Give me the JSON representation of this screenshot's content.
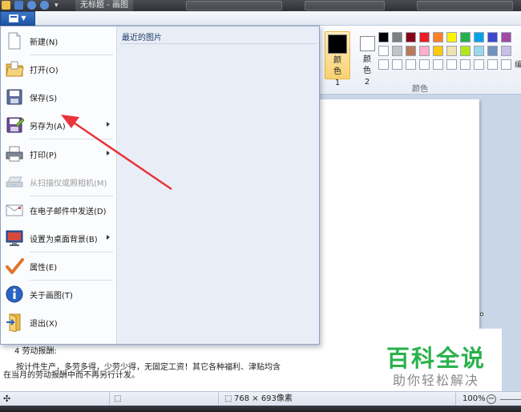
{
  "titlebar": {
    "title": "无标题 - 画图"
  },
  "file_menu": {
    "items": [
      {
        "label": "新建(N)",
        "icon": "new-file-icon",
        "submenu": false,
        "enabled": true
      },
      {
        "label": "打开(O)",
        "icon": "open-folder-icon",
        "submenu": false,
        "enabled": true
      },
      {
        "label": "保存(S)",
        "icon": "save-disk-icon",
        "submenu": false,
        "enabled": true
      },
      {
        "label": "另存为(A)",
        "icon": "save-as-icon",
        "submenu": true,
        "enabled": true
      },
      {
        "label": "打印(P)",
        "icon": "printer-icon",
        "submenu": true,
        "enabled": true
      },
      {
        "label": "从扫描仪或照相机(M)",
        "icon": "scanner-icon",
        "submenu": false,
        "enabled": false
      },
      {
        "label": "在电子邮件中发送(D)",
        "icon": "email-icon",
        "submenu": false,
        "enabled": true
      },
      {
        "label": "设置为桌面背景(B)",
        "icon": "desktop-background-icon",
        "submenu": true,
        "enabled": true
      },
      {
        "label": "属性(E)",
        "icon": "properties-check-icon",
        "submenu": false,
        "enabled": true
      },
      {
        "label": "关于画图(T)",
        "icon": "info-icon",
        "submenu": false,
        "enabled": true
      },
      {
        "label": "退出(X)",
        "icon": "exit-icon",
        "submenu": false,
        "enabled": true
      }
    ],
    "recent_title": "最近的图片"
  },
  "ribbon": {
    "color1_label": "颜色 1",
    "color2_label": "颜色 2",
    "colors_group_label": "颜色",
    "edit_colors_label": "编",
    "color1": "#000000",
    "color2": "#ffffff",
    "palette": [
      [
        "#000000",
        "#7f7f7f",
        "#880015",
        "#ed1c24",
        "#ff7f27",
        "#fff200",
        "#22b14c",
        "#00a2e8",
        "#3f48cc",
        "#a349a4"
      ],
      [
        "#ffffff",
        "#c3c3c3",
        "#b97a57",
        "#ffaec9",
        "#ffc90e",
        "#efe4b0",
        "#b5e61d",
        "#99d9ea",
        "#7092be",
        "#c8bfe7"
      ],
      [
        "#ffffff",
        "#ffffff",
        "#ffffff",
        "#ffffff",
        "#ffffff",
        "#ffffff",
        "#ffffff",
        "#ffffff",
        "#ffffff",
        "#ffffff"
      ]
    ]
  },
  "document": {
    "heading": "4 劳动报酬:",
    "line1": "按计件生产，多劳多得，少劳少得，无固定工资！其它各种福利、津贴均含",
    "line2": "在当月的劳动报酬中而不再另行计发。"
  },
  "watermark": {
    "title": "百科全说",
    "subtitle": "助你轻松解决"
  },
  "statusbar": {
    "move_icon": "move-cursor-icon",
    "size_text": "768 × 693像素",
    "zoom": "100%"
  }
}
